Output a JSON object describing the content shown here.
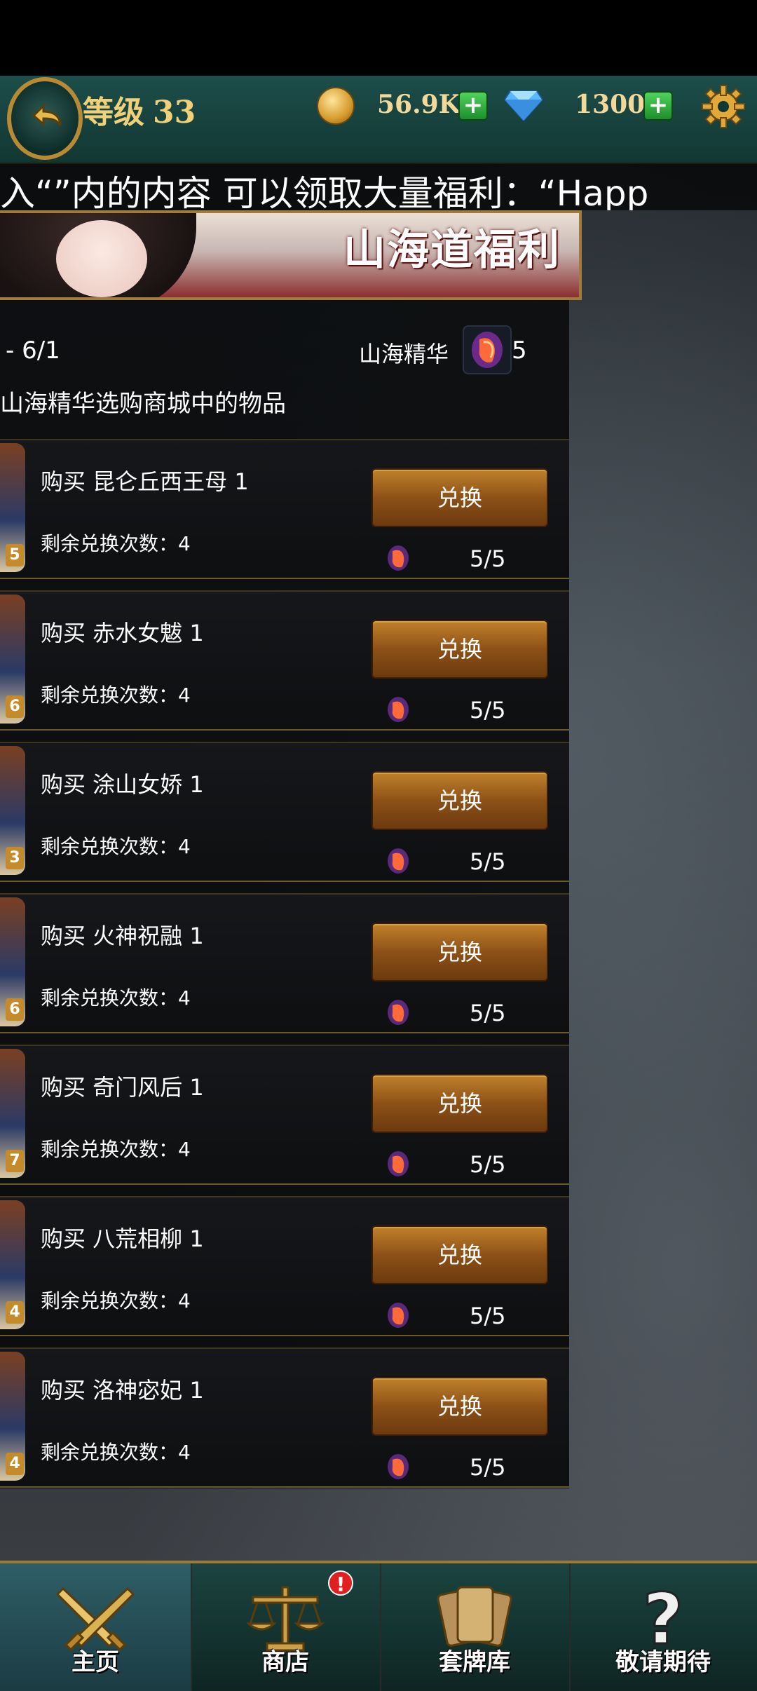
{
  "header": {
    "level_label": "等级",
    "level_value": "33",
    "coins": "56.9K",
    "gems": "1300",
    "plus_symbol": "+"
  },
  "marquee": "入“”内的内容 可以领取大量福利：“Happ",
  "banner": {
    "title": "山海道福利"
  },
  "panel": {
    "date_range": "- 6/1",
    "essence_label": "山海精华",
    "essence_count": "5",
    "description": "山海精华选购商城中的物品"
  },
  "items": [
    {
      "name": "购买  昆仑丘西王母  1",
      "remaining": "剩余兑换次数：4",
      "button": "兑换",
      "cost": "5/5",
      "badge": "5"
    },
    {
      "name": "购买  赤水女魃  1",
      "remaining": "剩余兑换次数：4",
      "button": "兑换",
      "cost": "5/5",
      "badge": "6"
    },
    {
      "name": "购买  涂山女娇  1",
      "remaining": "剩余兑换次数：4",
      "button": "兑换",
      "cost": "5/5",
      "badge": "3"
    },
    {
      "name": "购买  火神祝融  1",
      "remaining": "剩余兑换次数：4",
      "button": "兑换",
      "cost": "5/5",
      "badge": "6"
    },
    {
      "name": "购买  奇门风后  1",
      "remaining": "剩余兑换次数：4",
      "button": "兑换",
      "cost": "5/5",
      "badge": "7"
    },
    {
      "name": "购买  八荒相柳  1",
      "remaining": "剩余兑换次数：4",
      "button": "兑换",
      "cost": "5/5",
      "badge": "4"
    },
    {
      "name": "购买  洛神宓妃  1",
      "remaining": "剩余兑换次数：4",
      "button": "兑换",
      "cost": "5/5",
      "badge": "4"
    }
  ],
  "nav": {
    "home": "主页",
    "shop": "商店",
    "deck": "套牌库",
    "coming": "敬请期待",
    "shop_alert": "!"
  },
  "colors": {
    "accent_gold": "#f0d17a",
    "button_bronze": "#8d5117",
    "nav_teal": "#1b4440"
  },
  "icons": [
    "back-arrow-icon",
    "coin-icon",
    "gem-icon",
    "gear-icon",
    "essence-icon",
    "crossed-swords-icon",
    "scales-icon",
    "cards-icon",
    "question-icon"
  ]
}
